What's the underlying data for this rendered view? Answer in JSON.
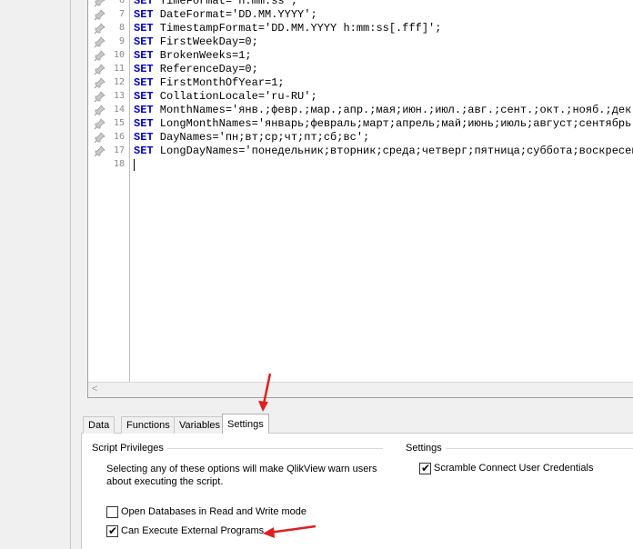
{
  "editor": {
    "lines": [
      {
        "num": "6",
        "keyword": "SET",
        "text": " TimeFormat='h:mm:ss';"
      },
      {
        "num": "7",
        "keyword": "SET",
        "text": " DateFormat='DD.MM.YYYY';"
      },
      {
        "num": "8",
        "keyword": "SET",
        "text": " TimestampFormat='DD.MM.YYYY h:mm:ss[.fff]';"
      },
      {
        "num": "9",
        "keyword": "SET",
        "text": " FirstWeekDay=0;"
      },
      {
        "num": "10",
        "keyword": "SET",
        "text": " BrokenWeeks=1;"
      },
      {
        "num": "11",
        "keyword": "SET",
        "text": " ReferenceDay=0;"
      },
      {
        "num": "12",
        "keyword": "SET",
        "text": " FirstMonthOfYear=1;"
      },
      {
        "num": "13",
        "keyword": "SET",
        "text": " CollationLocale='ru-RU';"
      },
      {
        "num": "14",
        "keyword": "SET",
        "text": " MonthNames='янв.;февр.;мар.;апр.;мая;июн.;июл.;авг.;сент.;окт.;нояб.;дек.';"
      },
      {
        "num": "15",
        "keyword": "SET",
        "text": " LongMonthNames='январь;февраль;март;апрель;май;июнь;июль;август;сентябрь;октябрь;ноябрь;декабрь';"
      },
      {
        "num": "16",
        "keyword": "SET",
        "text": " DayNames='пн;вт;ср;чт;пт;сб;вс';"
      },
      {
        "num": "17",
        "keyword": "SET",
        "text": " LongDayNames='понедельник;вторник;среда;четверг;пятница;суббота;воскресенье';"
      },
      {
        "num": "18",
        "keyword": "",
        "text": ""
      }
    ],
    "keyword_color": "#0000c8"
  },
  "tabs": [
    {
      "label": "Data"
    },
    {
      "label": "Functions"
    },
    {
      "label": "Variables"
    },
    {
      "label": "Settings",
      "active": true
    }
  ],
  "script_privileges": {
    "title": "Script Privileges",
    "description": "Selecting any of these options will make QlikView warn users about executing the script.",
    "open_db_label": "Open Databases in Read and Write mode",
    "open_db_checked": false,
    "can_execute_label": "Can Execute External Programs",
    "can_execute_checked": true
  },
  "settings": {
    "title": "Settings",
    "scramble_label": "Scramble Connect User Credentials",
    "scramble_checked": true
  },
  "annotation_color": "#e02020"
}
